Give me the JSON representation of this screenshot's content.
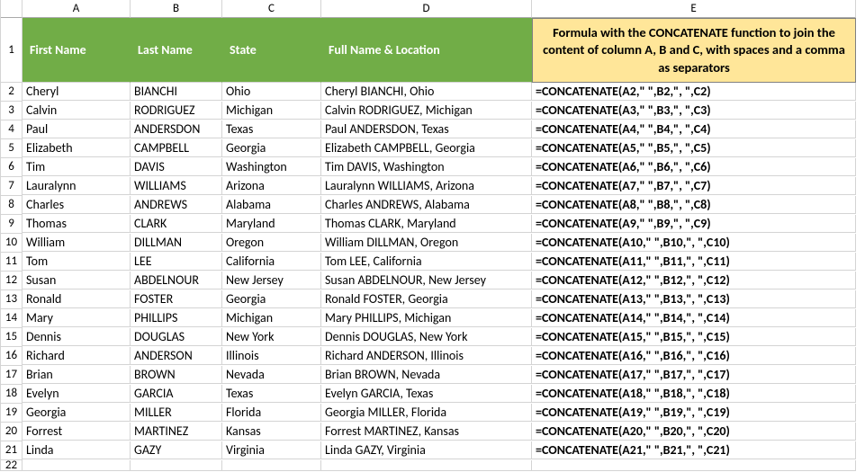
{
  "colhdrs": {
    "A": "A",
    "B": "B",
    "C": "C",
    "D": "D",
    "E": "E"
  },
  "rowhdrs": [
    "1",
    "2",
    "3",
    "4",
    "5",
    "6",
    "7",
    "8",
    "9",
    "10",
    "11",
    "12",
    "13",
    "14",
    "15",
    "16",
    "17",
    "18",
    "19",
    "20",
    "21",
    "22"
  ],
  "header": {
    "first": "First Name",
    "last": "Last Name",
    "state": "State",
    "full": "Full Name & Location",
    "formula": "Formula with the CONCATENATE function to join the content of column A, B and C, with spaces and a comma as separators"
  },
  "rows": [
    {
      "r": "2",
      "first": "Cheryl",
      "last": "BIANCHI",
      "state": "Ohio",
      "full": "Cheryl BIANCHI, Ohio",
      "formula": "=CONCATENATE(A2,\" \",B2,\", \",C2)"
    },
    {
      "r": "3",
      "first": "Calvin",
      "last": "RODRIGUEZ",
      "state": "Michigan",
      "full": "Calvin RODRIGUEZ, Michigan",
      "formula": "=CONCATENATE(A3,\" \",B3,\", \",C3)"
    },
    {
      "r": "4",
      "first": "Paul",
      "last": "ANDERSDON",
      "state": "Texas",
      "full": "Paul ANDERSDON, Texas",
      "formula": "=CONCATENATE(A4,\" \",B4,\", \",C4)"
    },
    {
      "r": "5",
      "first": "Elizabeth",
      "last": "CAMPBELL",
      "state": "Georgia",
      "full": "Elizabeth CAMPBELL, Georgia",
      "formula": "=CONCATENATE(A5,\" \",B5,\", \",C5)"
    },
    {
      "r": "6",
      "first": "Tim",
      "last": "DAVIS",
      "state": "Washington",
      "full": "Tim DAVIS, Washington",
      "formula": "=CONCATENATE(A6,\" \",B6,\", \",C6)"
    },
    {
      "r": "7",
      "first": "Lauralynn",
      "last": "WILLIAMS",
      "state": "Arizona",
      "full": "Lauralynn WILLIAMS, Arizona",
      "formula": "=CONCATENATE(A7,\" \",B7,\", \",C7)"
    },
    {
      "r": "8",
      "first": "Charles",
      "last": "ANDREWS",
      "state": "Alabama",
      "full": "Charles ANDREWS, Alabama",
      "formula": "=CONCATENATE(A8,\" \",B8,\", \",C8)"
    },
    {
      "r": "9",
      "first": "Thomas",
      "last": "CLARK",
      "state": "Maryland",
      "full": "Thomas CLARK, Maryland",
      "formula": "=CONCATENATE(A9,\" \",B9,\", \",C9)"
    },
    {
      "r": "10",
      "first": "William",
      "last": "DILLMAN",
      "state": "Oregon",
      "full": "William DILLMAN, Oregon",
      "formula": "=CONCATENATE(A10,\" \",B10,\", \",C10)"
    },
    {
      "r": "11",
      "first": "Tom",
      "last": "LEE",
      "state": "California",
      "full": "Tom LEE, California",
      "formula": "=CONCATENATE(A11,\" \",B11,\", \",C11)"
    },
    {
      "r": "12",
      "first": "Susan",
      "last": "ABDELNOUR",
      "state": "New Jersey",
      "full": "Susan ABDELNOUR, New Jersey",
      "formula": "=CONCATENATE(A12,\" \",B12,\", \",C12)"
    },
    {
      "r": "13",
      "first": "Ronald",
      "last": "FOSTER",
      "state": "Georgia",
      "full": "Ronald FOSTER, Georgia",
      "formula": "=CONCATENATE(A13,\" \",B13,\", \",C13)"
    },
    {
      "r": "14",
      "first": "Mary",
      "last": "PHILLIPS",
      "state": "Michigan",
      "full": "Mary PHILLIPS, Michigan",
      "formula": "=CONCATENATE(A14,\" \",B14,\", \",C14)"
    },
    {
      "r": "15",
      "first": "Dennis",
      "last": "DOUGLAS",
      "state": "New York",
      "full": "Dennis DOUGLAS, New York",
      "formula": "=CONCATENATE(A15,\" \",B15,\", \",C15)"
    },
    {
      "r": "16",
      "first": "Richard",
      "last": "ANDERSON",
      "state": "Illinois",
      "full": "Richard ANDERSON, Illinois",
      "formula": "=CONCATENATE(A16,\" \",B16,\", \",C16)"
    },
    {
      "r": "17",
      "first": "Brian",
      "last": "BROWN",
      "state": "Nevada",
      "full": "Brian BROWN, Nevada",
      "formula": "=CONCATENATE(A17,\" \",B17,\", \",C17)"
    },
    {
      "r": "18",
      "first": "Evelyn",
      "last": "GARCIA",
      "state": "Texas",
      "full": "Evelyn GARCIA, Texas",
      "formula": "=CONCATENATE(A18,\" \",B18,\", \",C18)"
    },
    {
      "r": "19",
      "first": "Georgia",
      "last": "MILLER",
      "state": "Florida",
      "full": "Georgia MILLER, Florida",
      "formula": "=CONCATENATE(A19,\" \",B19,\", \",C19)"
    },
    {
      "r": "20",
      "first": "Forrest",
      "last": "MARTINEZ",
      "state": "Kansas",
      "full": "Forrest MARTINEZ, Kansas",
      "formula": "=CONCATENATE(A20,\" \",B20,\", \",C20)"
    },
    {
      "r": "21",
      "first": "Linda",
      "last": "GAZY",
      "state": "Virginia",
      "full": "Linda GAZY, Virginia",
      "formula": "=CONCATENATE(A21,\" \",B21,\", \",C21)"
    }
  ]
}
